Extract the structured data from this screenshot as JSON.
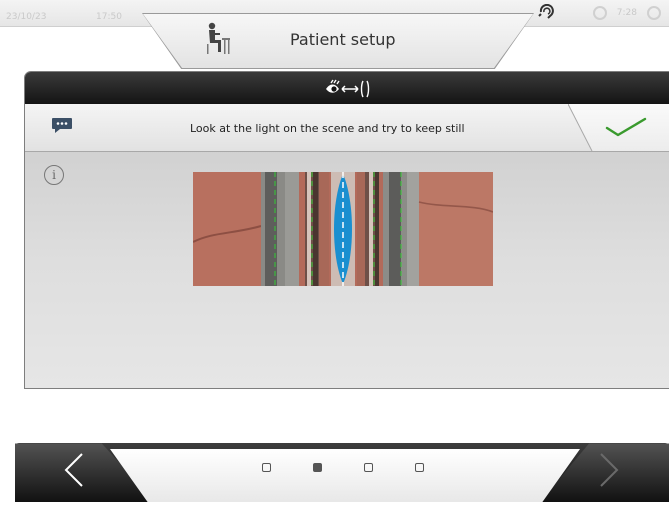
{
  "status": {
    "date": "23/10/23",
    "time": "17:50",
    "counter": "7:28"
  },
  "title": "Patient setup",
  "instruction": "Look at the light on the scene and try to keep still",
  "info_glyph": "i",
  "navigation": {
    "pages": [
      false,
      true,
      false,
      false
    ]
  },
  "colors": {
    "accent_check": "#3a9a2e",
    "camera_tissue": "#b36a5a",
    "alignment_blue": "#1a8fd0"
  }
}
